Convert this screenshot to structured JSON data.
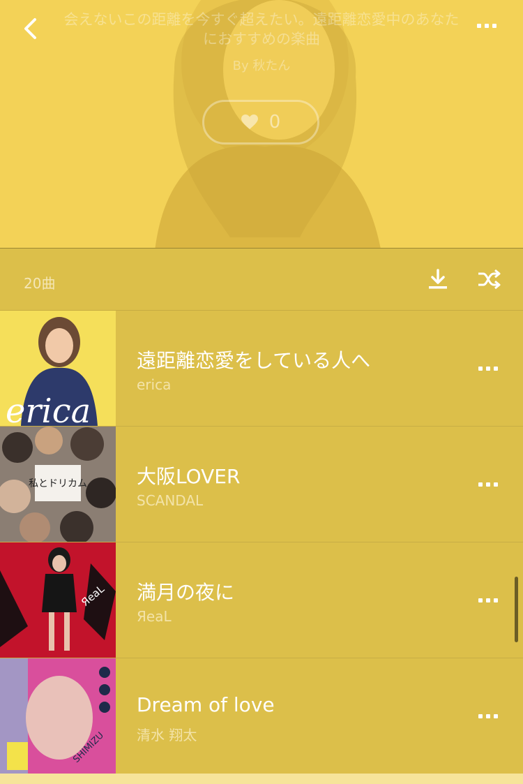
{
  "header": {
    "description_line1": "会えないこの距離を今すぐ超えたい。遠距離恋愛中のあなた",
    "description_line2": "におすすめの楽曲",
    "byline": "By 秋たん",
    "like_count": "0",
    "icons": {
      "back": "back-chevron-icon",
      "more": "more-dots-icon",
      "heart": "heart-icon"
    }
  },
  "toolbar": {
    "track_count": "20曲",
    "icons": {
      "download": "download-icon",
      "shuffle": "shuffle-icon"
    }
  },
  "tracks": [
    {
      "title": "遠距離恋愛をしている人へ",
      "artist": "erica",
      "cover_text": "erica"
    },
    {
      "title": "大阪LOVER",
      "artist": "SCANDAL",
      "cover_text": "私とドリカム"
    },
    {
      "title": "満月の夜に",
      "artist": "ЯeaL",
      "cover_text": "ЯeaL"
    },
    {
      "title": "Dream of love",
      "artist": "清水 翔太",
      "cover_text": "SHIMIZU"
    }
  ],
  "colors": {
    "hero_bg": "#f3d257",
    "list_bg": "#dcbf4a",
    "text_primary": "#ffffff"
  }
}
